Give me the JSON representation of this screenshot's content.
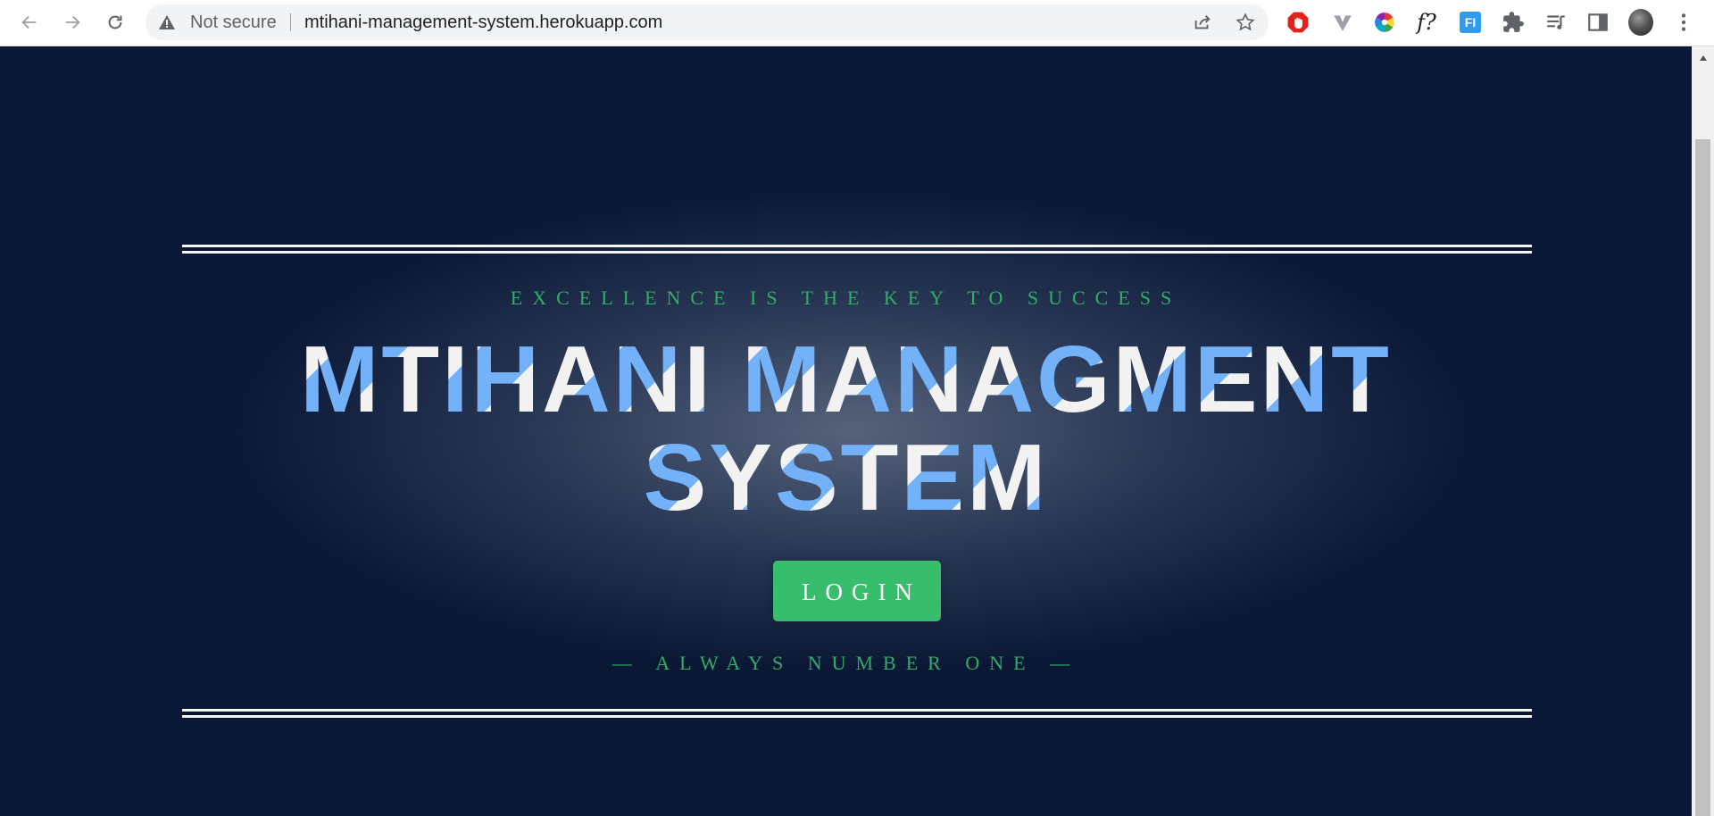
{
  "browser": {
    "security_label": "Not secure",
    "url": "mtihani-management-system.herokuapp.com",
    "icons": [
      "back-icon",
      "forward-icon",
      "reload-icon",
      "warning-icon",
      "share-icon",
      "bookmark-star-icon",
      "adblock-icon",
      "vivaldi-icon",
      "color-wheel-icon",
      "font-finder-icon",
      "fi-extension-icon",
      "extensions-puzzle-icon",
      "reading-list-icon",
      "side-panel-icon",
      "profile-avatar",
      "menu-kebab-icon"
    ],
    "font_ext_label": "f?",
    "fi_ext_label": "FI"
  },
  "page": {
    "tagline": "EXCELLENCE IS THE KEY TO SUCCESS",
    "title_line1": "MTIHANI MANAGMENT",
    "title_line2": "SYSTEM",
    "login_label": "LOGIN",
    "motto": "— ALWAYS NUMBER ONE —"
  },
  "colors": {
    "background": "#0a1836",
    "accent_green": "#37bd6b",
    "tagline_green": "#2fae66",
    "title_blue": "#73b1f9",
    "title_white": "#f2f2f2"
  }
}
